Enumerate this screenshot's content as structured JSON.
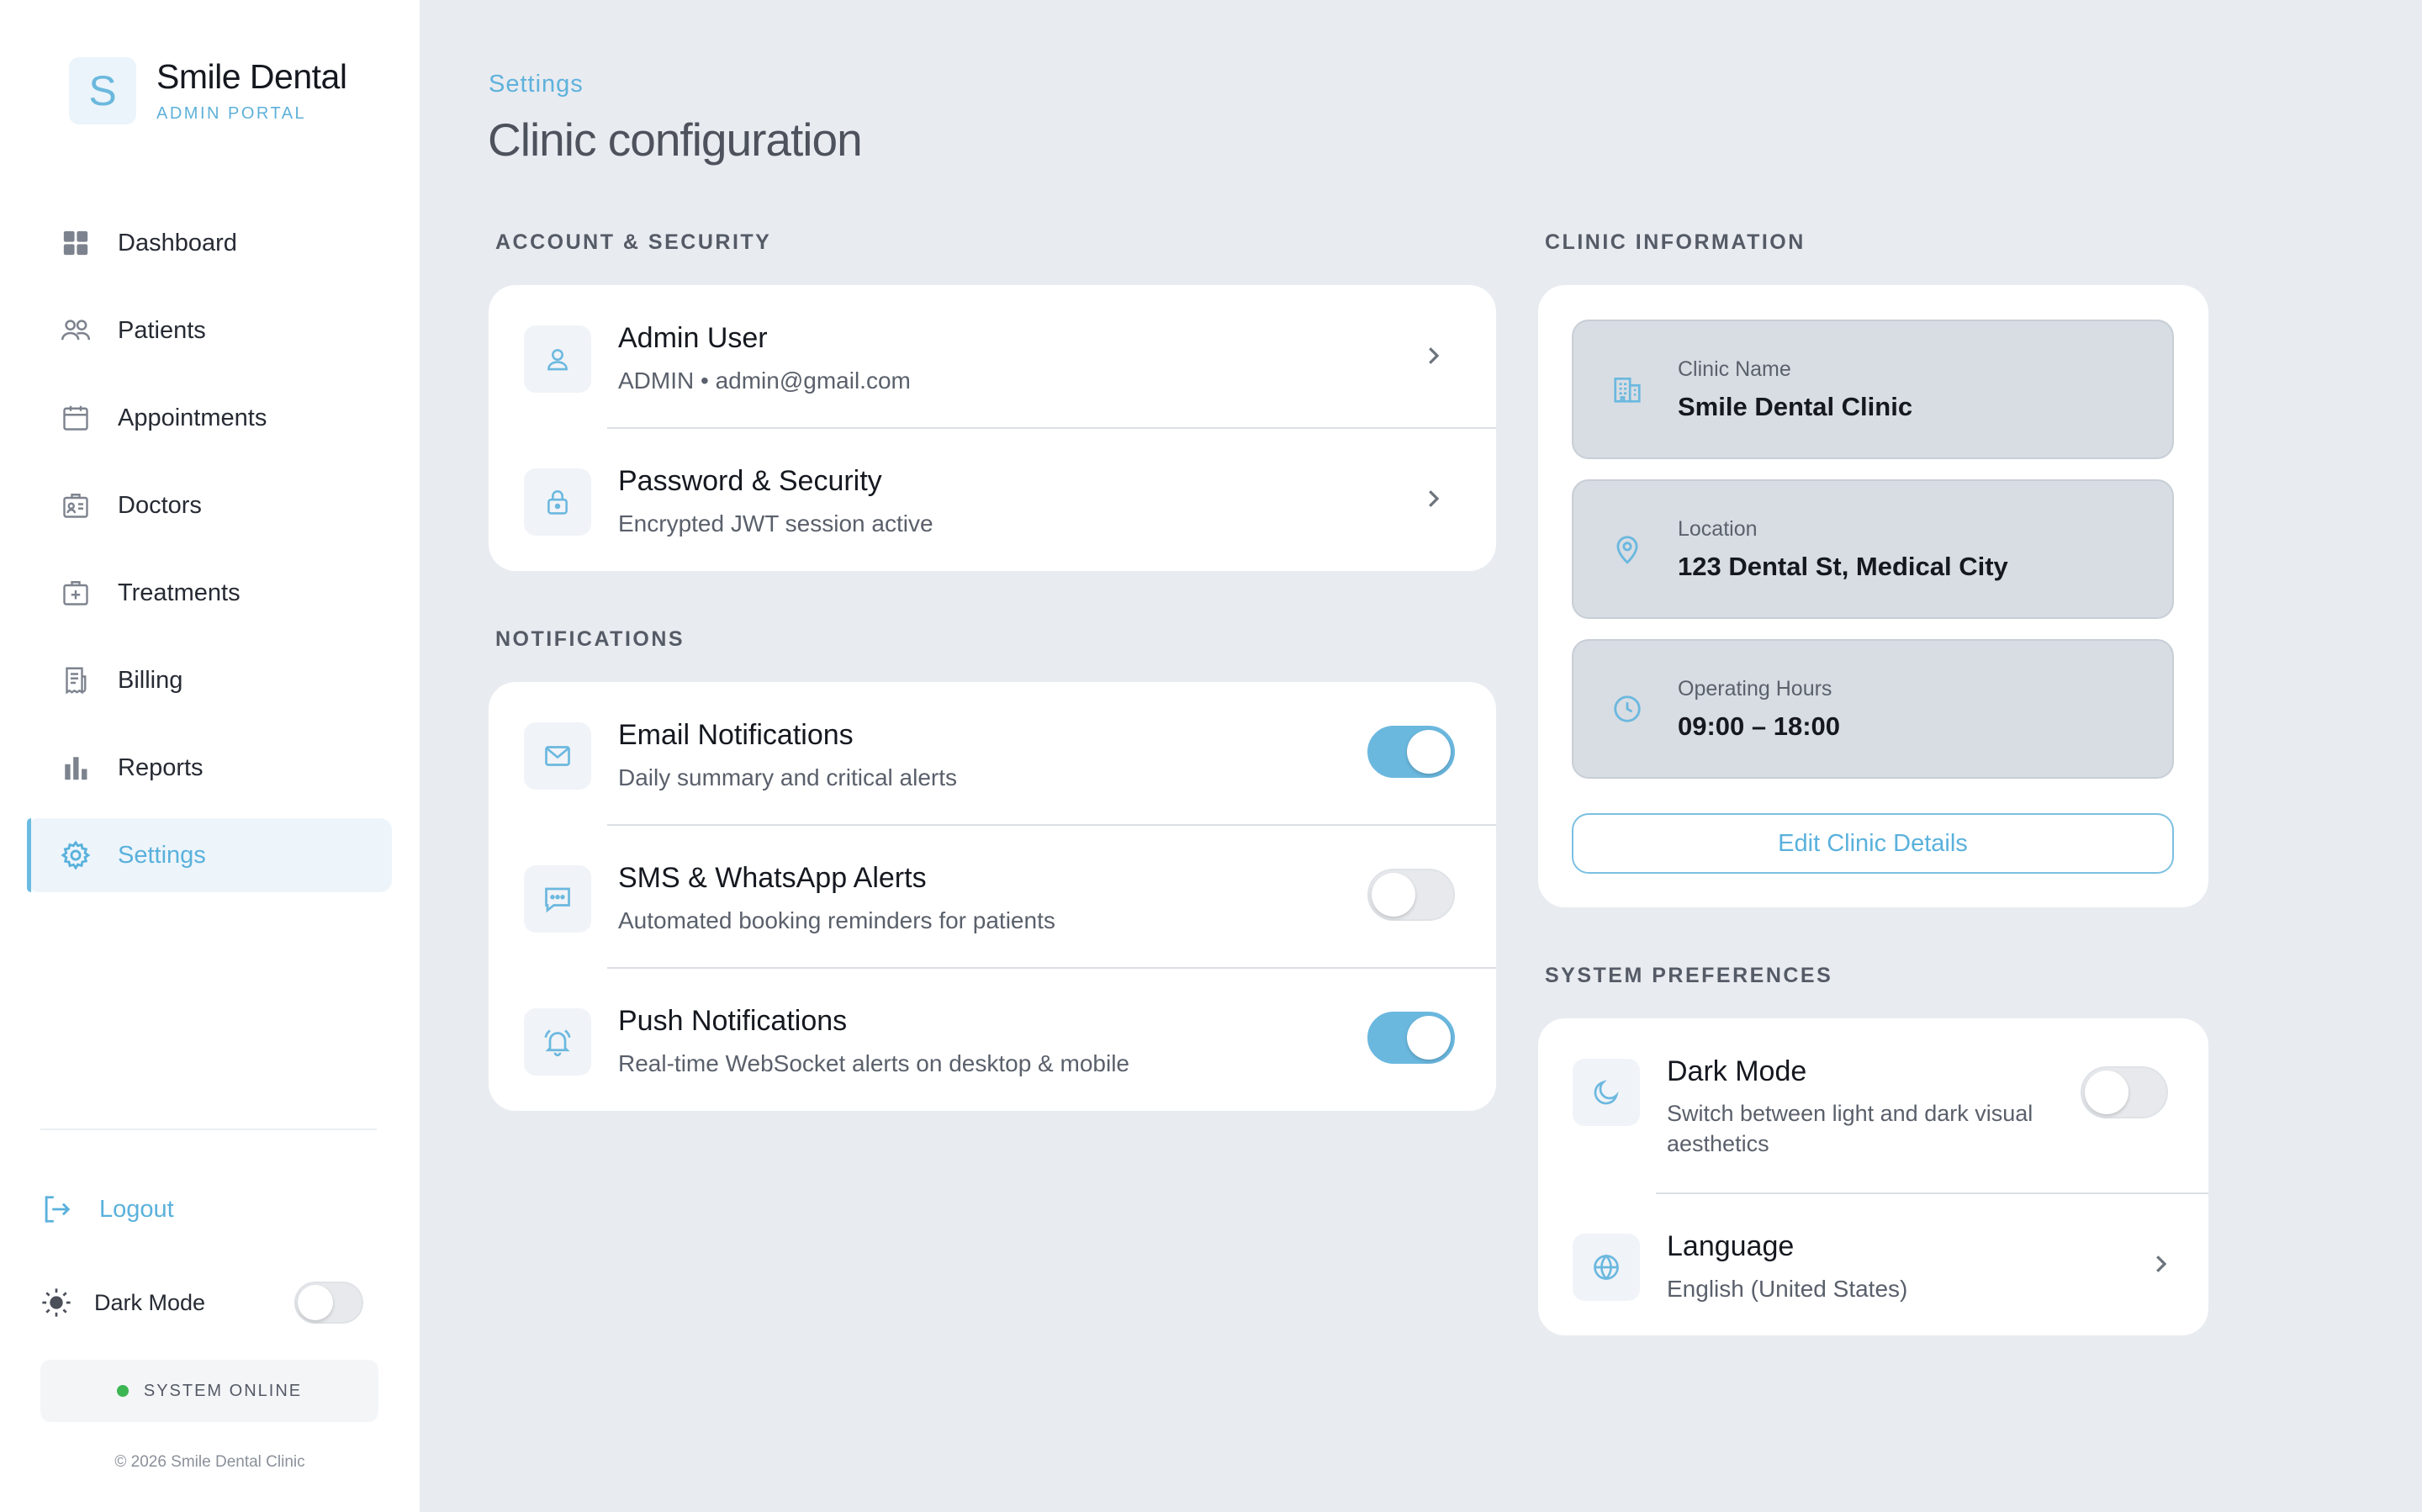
{
  "brand": {
    "initial": "S",
    "name": "Smile Dental",
    "subtitle": "ADMIN PORTAL"
  },
  "sidebar": {
    "items": [
      {
        "label": "Dashboard",
        "icon": "grid-icon"
      },
      {
        "label": "Patients",
        "icon": "users-icon"
      },
      {
        "label": "Appointments",
        "icon": "calendar-icon"
      },
      {
        "label": "Doctors",
        "icon": "id-card-icon"
      },
      {
        "label": "Treatments",
        "icon": "medical-kit-icon"
      },
      {
        "label": "Billing",
        "icon": "receipt-icon"
      },
      {
        "label": "Reports",
        "icon": "bar-chart-icon"
      },
      {
        "label": "Settings",
        "icon": "gear-icon",
        "active": true
      }
    ],
    "logout_label": "Logout",
    "dark_mode_label": "Dark Mode",
    "dark_mode_on": false,
    "status_text": "SYSTEM ONLINE",
    "copyright": "© 2026 Smile Dental Clinic"
  },
  "header": {
    "breadcrumb": "Settings",
    "title": "Clinic configuration"
  },
  "account_section": {
    "label": "ACCOUNT & SECURITY",
    "items": [
      {
        "title": "Admin User",
        "subtitle": "ADMIN • admin@gmail.com"
      },
      {
        "title": "Password & Security",
        "subtitle": "Encrypted JWT session active"
      }
    ]
  },
  "notifications_section": {
    "label": "NOTIFICATIONS",
    "items": [
      {
        "title": "Email Notifications",
        "subtitle": "Daily summary and critical alerts",
        "enabled": true
      },
      {
        "title": "SMS & WhatsApp Alerts",
        "subtitle": "Automated booking reminders for patients",
        "enabled": false
      },
      {
        "title": "Push Notifications",
        "subtitle": "Real-time WebSocket alerts on desktop & mobile",
        "enabled": true
      }
    ]
  },
  "clinic_section": {
    "label": "CLINIC INFORMATION",
    "fields": [
      {
        "label": "Clinic Name",
        "value": "Smile Dental Clinic"
      },
      {
        "label": "Location",
        "value": "123 Dental St, Medical City"
      },
      {
        "label": "Operating Hours",
        "value": "09:00 – 18:00"
      }
    ],
    "edit_label": "Edit Clinic Details"
  },
  "preferences_section": {
    "label": "SYSTEM PREFERENCES",
    "dark_mode": {
      "title": "Dark Mode",
      "subtitle": "Switch between light and dark visual aesthetics",
      "enabled": false
    },
    "language": {
      "title": "Language",
      "subtitle": "English (United States)"
    }
  },
  "colors": {
    "accent": "#6bb8df",
    "background": "#e8ebf0",
    "card": "#ffffff",
    "status_online": "#3cb553"
  }
}
